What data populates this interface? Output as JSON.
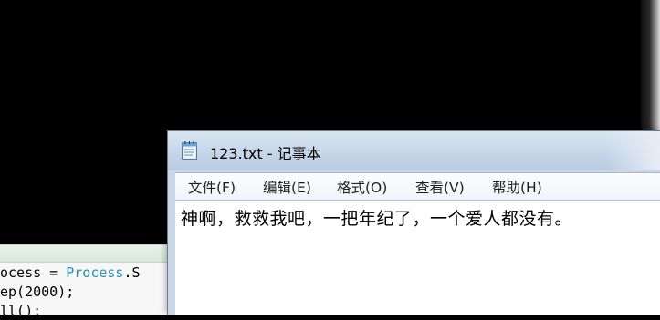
{
  "notepad": {
    "title": "123.txt - 记事本",
    "menu": [
      "文件(F)",
      "编辑(E)",
      "格式(O)",
      "查看(V)",
      "帮助(H)"
    ],
    "content": "神啊，救救我吧，一把年纪了，一个爱人都没有。"
  },
  "code_editor": {
    "lines": [
      {
        "pre": "ocess = ",
        "cls": "Process",
        "post": ".S"
      },
      {
        "pre": "ep(2000);",
        "cls": "",
        "post": ""
      },
      {
        "pre": "ll();",
        "cls": "",
        "post": ""
      }
    ]
  },
  "icons": {
    "notepad_app": "notepad-icon"
  }
}
